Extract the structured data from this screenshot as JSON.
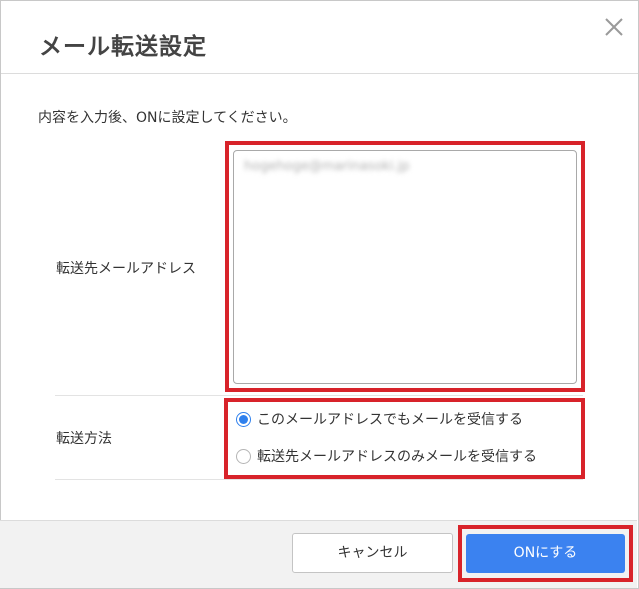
{
  "dialog": {
    "title": "メール転送設定",
    "close_icon": "close-icon"
  },
  "instruction": "内容を入力後、ONに設定してください。",
  "forward_address": {
    "label": "転送先メールアドレス",
    "value": "hogehoge@marinasoki.jp"
  },
  "forward_method": {
    "label": "転送方法",
    "options": [
      {
        "label": "このメールアドレスでもメールを受信する",
        "checked": true
      },
      {
        "label": "転送先メールアドレスのみメールを受信する",
        "checked": false
      }
    ]
  },
  "footer": {
    "cancel_label": "キャンセル",
    "on_label": "ONにする"
  },
  "colors": {
    "highlight": "#d8232a",
    "primary_button": "#3b82f0",
    "radio_checked": "#2f80ed"
  }
}
